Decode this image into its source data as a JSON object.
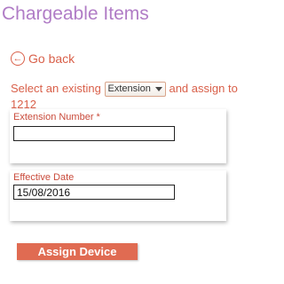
{
  "page": {
    "title": "Chargeable Items"
  },
  "back_link": {
    "icon": "arrow-left-circle-icon",
    "label": "Go back"
  },
  "instruction": {
    "prefix": "Select an existing",
    "select_value": "Extension",
    "suffix": "and assign to 1212"
  },
  "extension_field": {
    "label": "Extension Number *",
    "value": ""
  },
  "date_field": {
    "label": "Effective Date",
    "value": "15/08/2016"
  },
  "actions": {
    "assign_label": "Assign Device"
  },
  "colors": {
    "title": "#b07cc6",
    "accent": "#d9604a",
    "button": "#e06b52"
  }
}
